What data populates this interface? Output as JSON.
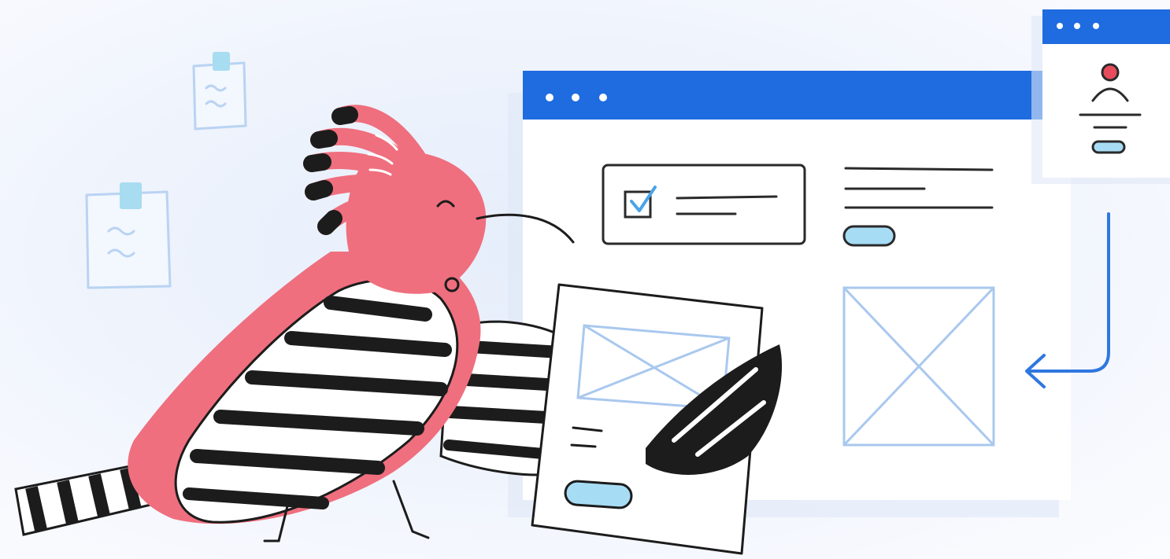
{
  "illustration": {
    "subject": "hoopoe-bird-holding-wireframe-card",
    "colors": {
      "background": "#eef3fc",
      "window_bar": "#1f6be0",
      "window_body": "#ffffff",
      "bird_pink": "#ef6f7e",
      "ink": "#1c1c1c",
      "wireframe_blue": "#a9c8ee",
      "button_fill": "#a7dcf5",
      "avatar_red": "#e84c5c",
      "arrow_blue": "#2f77e0",
      "sticky_tab": "#a8dcf0",
      "sticky_note_outline": "#b9d3f2"
    }
  }
}
